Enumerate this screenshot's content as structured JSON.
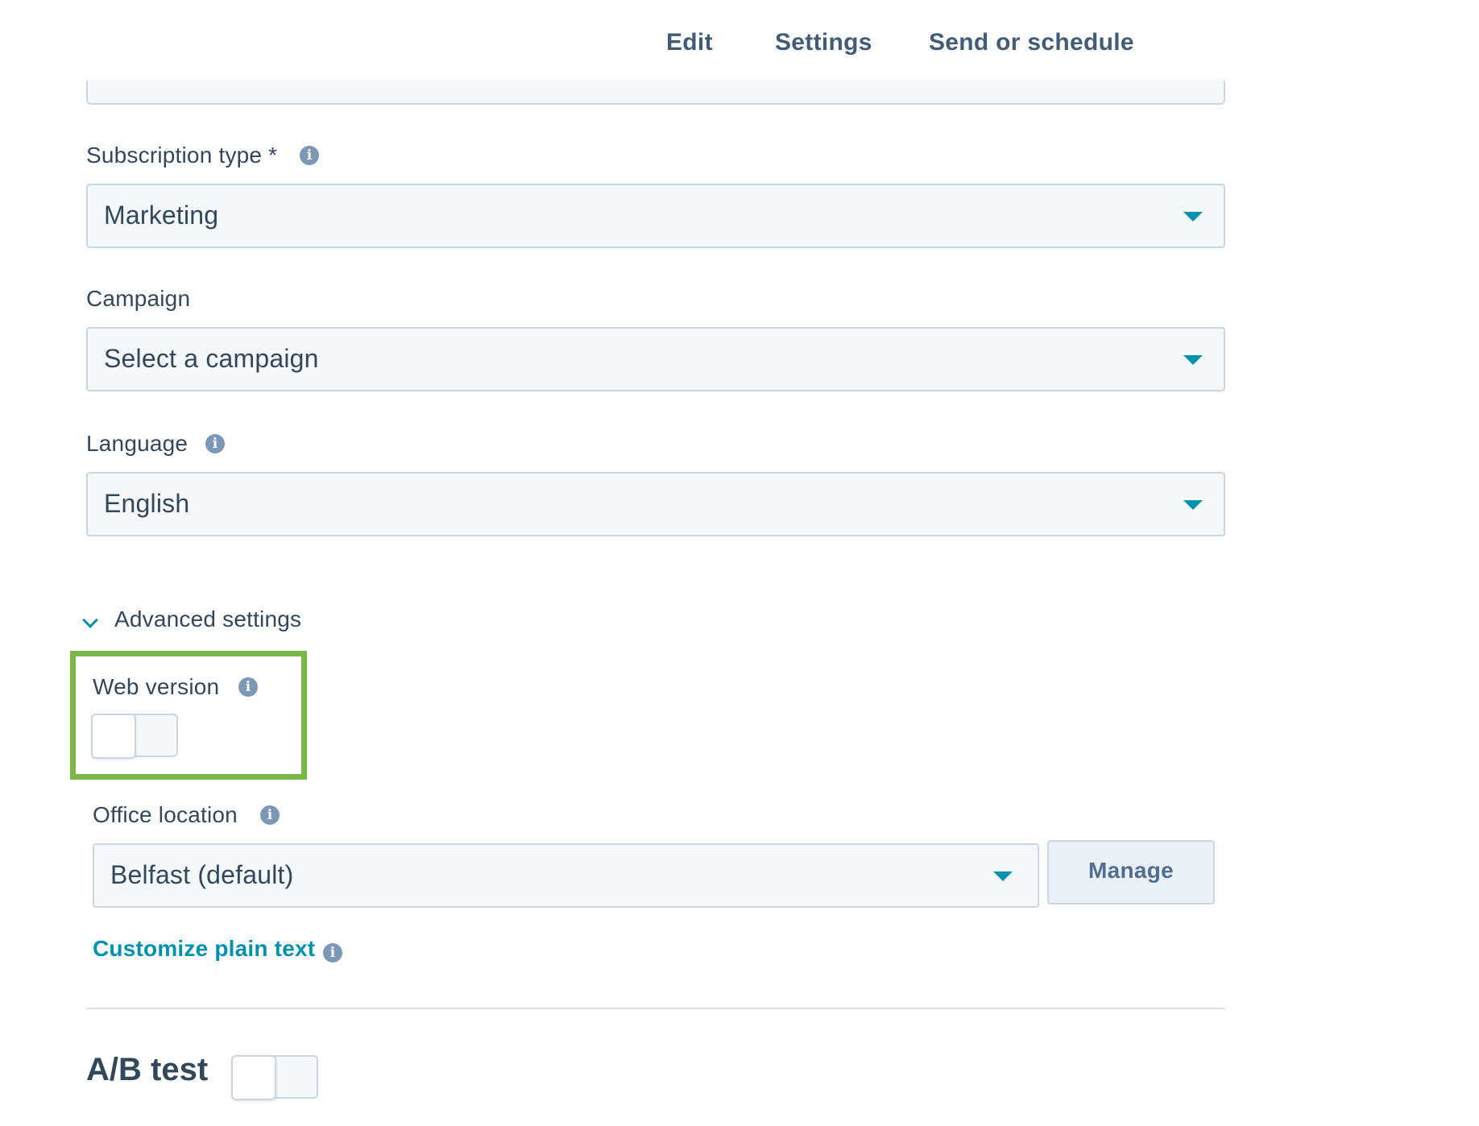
{
  "tabs": [
    {
      "label": "Edit",
      "active": false
    },
    {
      "label": "Settings",
      "active": true
    },
    {
      "label": "Send or schedule",
      "active": false
    }
  ],
  "subscription_type": {
    "label": "Subscription type *",
    "value": "Marketing"
  },
  "campaign": {
    "label": "Campaign",
    "value": "Select a campaign"
  },
  "language": {
    "label": "Language",
    "value": "English"
  },
  "advanced_settings": {
    "label": "Advanced settings",
    "expanded": true
  },
  "web_version": {
    "label": "Web version",
    "enabled": false
  },
  "office_location": {
    "label": "Office location",
    "value": "Belfast (default)",
    "manage_label": "Manage"
  },
  "customize_plain_text": {
    "label": "Customize plain text"
  },
  "ab_test": {
    "label": "A/B test",
    "enabled": false
  },
  "colors": {
    "accent": "#0091ae",
    "text": "#33475b",
    "field_bg": "#f5f8fa",
    "border": "#cbd6e2",
    "highlight": "#7ab648"
  },
  "icons": {
    "info": "info-circle-icon",
    "caret": "caret-down-icon",
    "chevron": "chevron-down-icon"
  }
}
